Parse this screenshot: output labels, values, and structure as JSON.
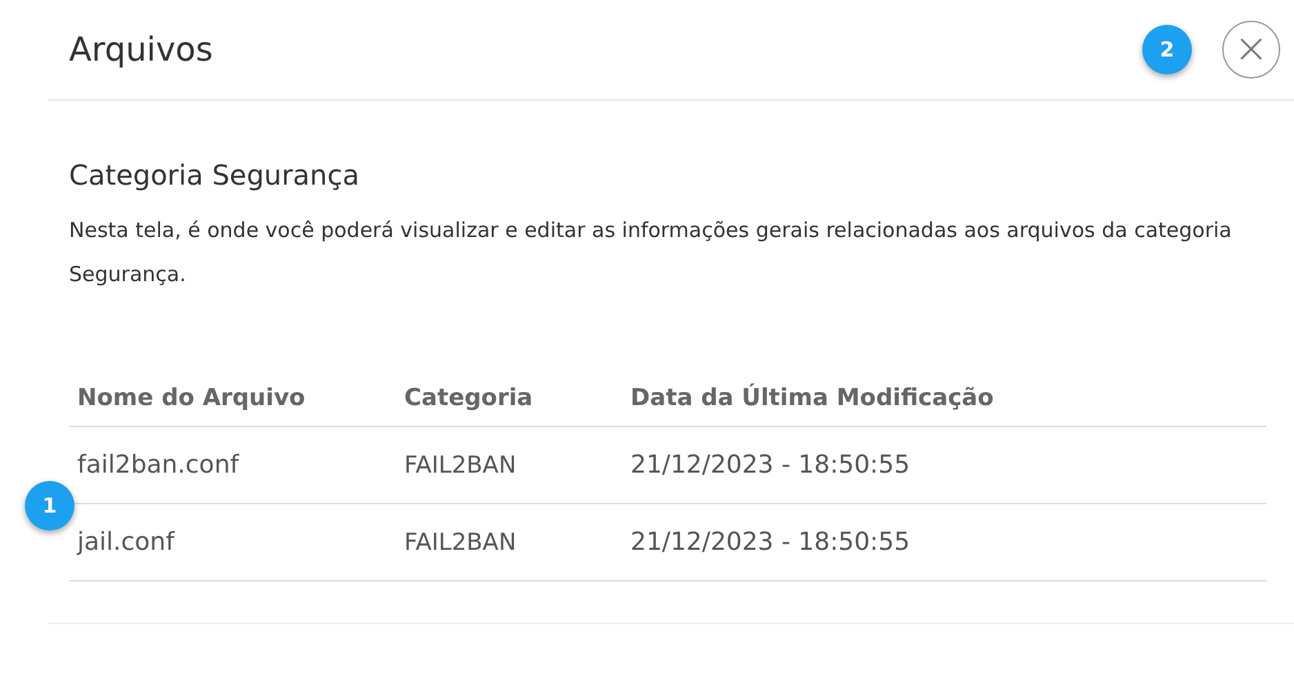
{
  "dialog": {
    "title": "Arquivos",
    "close": "×"
  },
  "section": {
    "title": "Categoria Segurança",
    "description": "Nesta tela, é onde você poderá visualizar e editar as informações gerais relacionadas aos arquivos da categoria Segurança."
  },
  "table": {
    "columns": [
      "Nome do Arquivo",
      "Categoria",
      "Data da Última Modificação"
    ],
    "rows": [
      {
        "cells": [
          "fail2ban.conf",
          "FAIL2BAN",
          "21/12/2023 - 18:50:55"
        ]
      },
      {
        "cells": [
          "jail.conf",
          "FAIL2BAN",
          "21/12/2023 - 18:50:55"
        ]
      }
    ]
  },
  "markers": [
    {
      "label": "2",
      "kind": "header"
    },
    {
      "label": "1",
      "kind": "table"
    }
  ]
}
